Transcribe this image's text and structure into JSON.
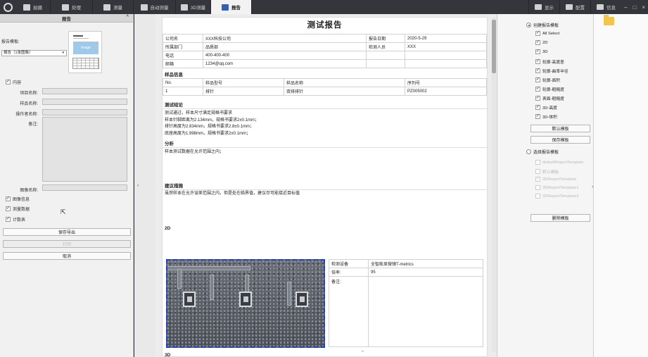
{
  "topbar": {
    "tabs": [
      {
        "label": "拍摄",
        "icon": "camera-icon"
      },
      {
        "label": "处理",
        "icon": "process-icon"
      },
      {
        "label": "测量",
        "icon": "measure-icon"
      },
      {
        "label": "自动测量",
        "icon": "auto-measure-icon"
      },
      {
        "label": "3D测量",
        "icon": "3d-measure-icon"
      },
      {
        "label": "报告",
        "icon": "report-icon"
      }
    ],
    "right": [
      {
        "label": "显示",
        "icon": "display-icon"
      },
      {
        "label": "配置",
        "icon": "config-icon"
      },
      {
        "label": "信息",
        "icon": "info-icon"
      }
    ],
    "window_controls": [
      "–",
      "□",
      "×"
    ]
  },
  "left_panel": {
    "title": "报告",
    "template_label": "报告模板:",
    "template_value": "报告（1张图像）",
    "thumb_image_text": "Image",
    "content_label": "内容",
    "fields": [
      {
        "label": "项目名称:"
      },
      {
        "label": "样品名称:"
      },
      {
        "label": "操作者名称:"
      },
      {
        "label": "备注:"
      }
    ],
    "image_name_label": "图像名称:",
    "options": [
      "图像信息",
      "测量数据",
      "计数表"
    ],
    "buttons": {
      "save_export": "保存导出",
      "print": "打印",
      "cancel": "取消"
    }
  },
  "report": {
    "title": "测试报告",
    "info_rows": [
      [
        "公司名",
        "XXX科技公司",
        "报告日期",
        "2020-5-29"
      ],
      [
        "所属部门",
        "品质部",
        "检测人员",
        "XXX"
      ],
      [
        "电话",
        "400-400-400",
        "",
        ""
      ],
      [
        "邮箱",
        "1234@qq.com",
        "",
        ""
      ]
    ],
    "sample_section": "样品信息",
    "sample_header": [
      "No.",
      "样品型号",
      "样品名称",
      "序列号"
    ],
    "sample_row": [
      "1",
      "排针",
      "双排排针",
      "PZ005002"
    ],
    "conclusion_title": "测试结论",
    "conclusion_lines": [
      "测试通过，样本尺寸满足规格书要求",
      "样本针脚距离为2.134mm，规格书要求2±0.1mm；",
      "排针高度为2.834mm，规格书要求2.8±0.1mm；",
      "底座高度为1.998mm，规格书要求2±0.1mm；"
    ],
    "analysis_title": "分析",
    "analysis_text": "样本测试数据在允许范围之内；",
    "advice_title": "建议措施",
    "advice_text": "虽然样本在允许误差范围之内，但是处在临界值，建议尽可能接近目标值",
    "section_2d": "2D",
    "image_info": [
      [
        "检测设备",
        "全智能显微镜T-metrics"
      ],
      [
        "倍率:",
        "95"
      ],
      [
        "备注:",
        ""
      ]
    ],
    "next_section": "3D"
  },
  "right_panel": {
    "create_label": "创建报告模板",
    "items": [
      {
        "label": "All Select",
        "checked": true
      },
      {
        "label": "2D",
        "checked": true
      },
      {
        "label": "3D",
        "checked": true
      },
      {
        "label": "轮廓-高度差",
        "checked": true
      },
      {
        "label": "轮廓-曲率半径",
        "checked": true
      },
      {
        "label": "轮廓-面积",
        "checked": true
      },
      {
        "label": "轮廓-粗糙度",
        "checked": true
      },
      {
        "label": "表面-粗糙度",
        "checked": true
      },
      {
        "label": "3D-高度",
        "checked": true
      },
      {
        "label": "3D-体积",
        "checked": true
      }
    ],
    "default_template_btn": "默认模板",
    "save_template_btn": "保存模板",
    "select_label": "选择报告模板",
    "templates": [
      {
        "label": "defaultReportTemplate",
        "checked": false
      },
      {
        "label": "默认模板",
        "checked": false
      },
      {
        "label": "3DReportTemplate",
        "checked": true
      },
      {
        "label": "3DReportTemplate1",
        "checked": false
      },
      {
        "label": "3DReportTemplate2",
        "checked": false
      }
    ],
    "delete_btn": "删除模板"
  },
  "colors": {
    "selection_border": "#1a3ed1",
    "topbar": "#34363b",
    "folder": "#f3c64b"
  }
}
